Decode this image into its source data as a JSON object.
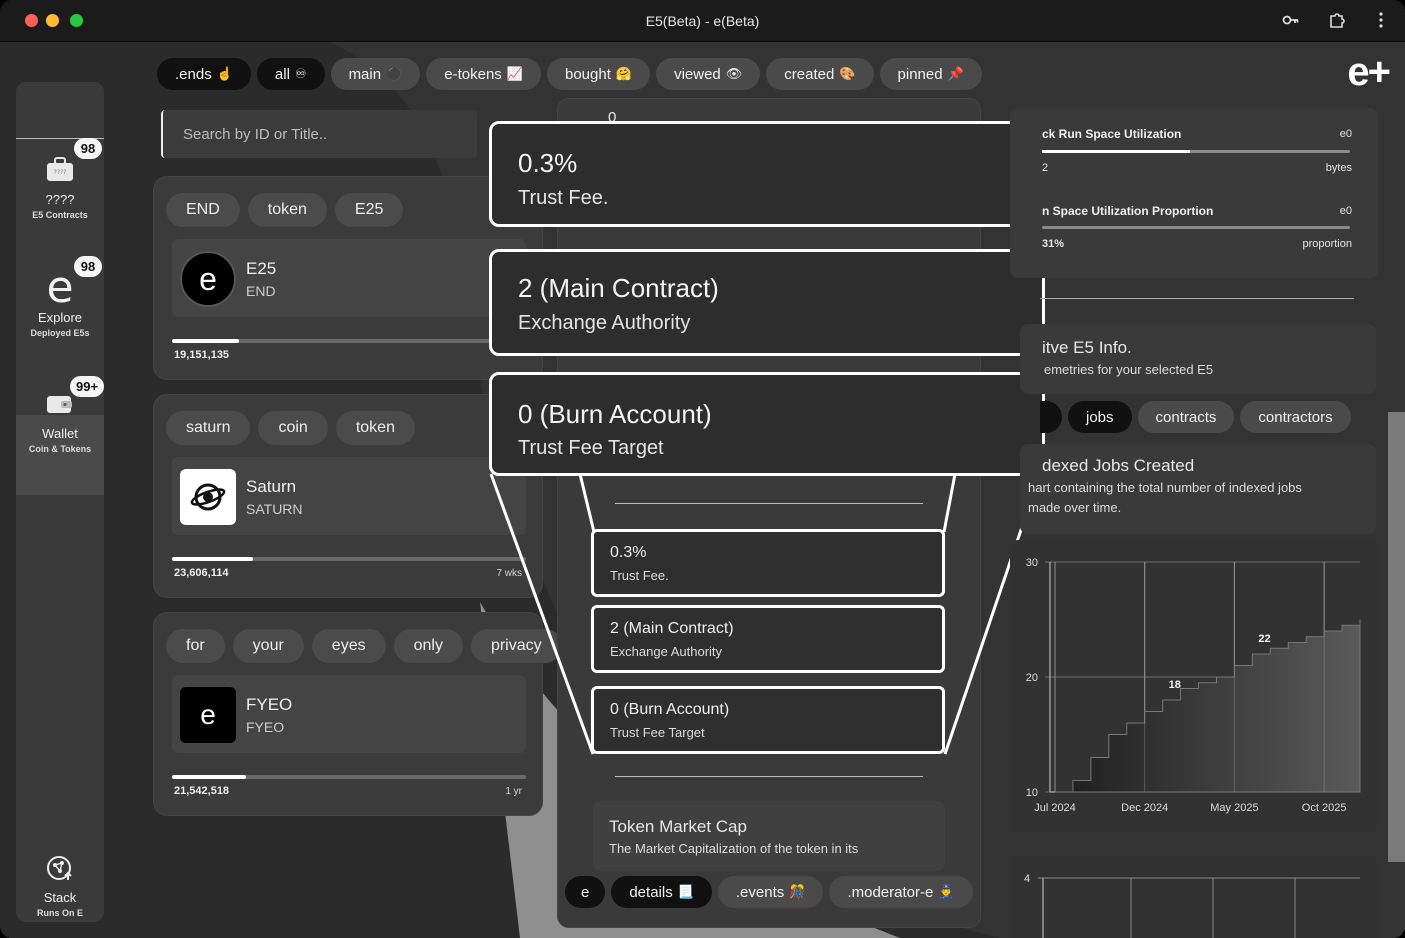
{
  "window": {
    "title": "E5(Beta) - e(Beta)",
    "toolbar_icons": [
      "key-icon",
      "extension-icon",
      "more-vertical-icon"
    ]
  },
  "sidebar": {
    "items": [
      {
        "icon": "briefcase-icon",
        "label": "????",
        "sub": "E5 Contracts",
        "badge": "98"
      },
      {
        "icon": "e-logo-icon",
        "label": "Explore",
        "sub": "Deployed E5s",
        "badge": "98"
      },
      {
        "icon": "wallet-icon",
        "label": "Wallet",
        "sub": "Coin & Tokens",
        "badge": "99+"
      },
      {
        "icon": "stack-icon",
        "label": "Stack",
        "sub": "Runs On E"
      }
    ]
  },
  "top_chips": [
    {
      "label": ".ends",
      "emoji": "☝",
      "dark": true
    },
    {
      "label": "all",
      "emoji": "♾",
      "dark": true
    },
    {
      "label": "main",
      "emoji": "⚫",
      "dark": false
    },
    {
      "label": "e-tokens",
      "emoji": "📈",
      "dark": false
    },
    {
      "label": "bought",
      "emoji": "🤗",
      "dark": false
    },
    {
      "label": "viewed",
      "emoji": "👁",
      "dark": false
    },
    {
      "label": "created",
      "emoji": "🎨",
      "dark": false
    },
    {
      "label": "pinned",
      "emoji": "📌",
      "dark": false
    }
  ],
  "brand": {
    "logo_text": "e+"
  },
  "search": {
    "placeholder": "Search by ID or Title.."
  },
  "tokens": [
    {
      "tags": [
        "END",
        "token",
        "E25"
      ],
      "name": "E25",
      "symbol": "END",
      "amount": "19,151,135",
      "age": "",
      "progress": 0.19
    },
    {
      "tags": [
        "saturn",
        "coin",
        "token"
      ],
      "name": "Saturn",
      "symbol": "SATURN",
      "amount": "23,606,114",
      "age": "7 wks",
      "progress": 0.23
    },
    {
      "tags": [
        "for",
        "your",
        "eyes",
        "only",
        "privacy"
      ],
      "name": "FYEO",
      "symbol": "FYEO",
      "amount": "21,542,518",
      "age": "1 yr",
      "progress": 0.21
    }
  ],
  "middle": {
    "top_fragment": "0",
    "popups": [
      {
        "value": "0.3%",
        "label": "Trust Fee."
      },
      {
        "value": "2 (Main Contract)",
        "label": "Exchange Authority"
      },
      {
        "value": "0 (Burn Account)",
        "label": "Trust Fee Target"
      }
    ],
    "details": [
      {
        "value": "0.3%",
        "label": "Trust Fee."
      },
      {
        "value": "2 (Main Contract)",
        "label": "Exchange Authority"
      },
      {
        "value": "0 (Burn Account)",
        "label": "Trust Fee Target"
      }
    ],
    "market_cap": {
      "title": "Token Market Cap",
      "desc": "The Market Capitalization of the token in its"
    },
    "bottom_chips": [
      {
        "label": "e",
        "emoji": "",
        "dark": true
      },
      {
        "label": "details",
        "emoji": "📃",
        "dark": true
      },
      {
        "label": ".events",
        "emoji": "🎊",
        "dark": false
      },
      {
        "label": ".moderator-e",
        "emoji": "👮",
        "dark": false
      }
    ]
  },
  "right": {
    "util1": {
      "label": "ck Run Space Utilization",
      "unit_top": "e0",
      "left_val": "2",
      "unit": "bytes",
      "progress": 0.48
    },
    "util2": {
      "label": "n Space Utilization Proportion",
      "unit_top": "e0",
      "left_val": "31%",
      "unit": "proportion",
      "progress": 0.0
    },
    "info": {
      "title": "itve E5 Info.",
      "sub": "emetries for your selected E5"
    },
    "tabs": [
      "jobs",
      "contracts",
      "contractors"
    ],
    "jobs": {
      "title": "dexed Jobs Created",
      "desc1": "hart containing the total number of indexed jobs",
      "desc2": "made over time."
    },
    "chart_axis_top": "4"
  },
  "chart_data": {
    "type": "area",
    "title": "",
    "xlabel": "",
    "ylabel": "",
    "x_ticks": [
      "Jul 2024",
      "Dec 2024",
      "May 2025",
      "Oct 2025"
    ],
    "y_ticks": [
      10,
      20,
      30
    ],
    "ylim": [
      10,
      30
    ],
    "annotations": [
      {
        "x": "Jan 2025",
        "y": 18,
        "label": "18"
      },
      {
        "x": "Jun 2025",
        "y": 22,
        "label": "22"
      }
    ],
    "series": [
      {
        "values": [
          {
            "x": "Jul 2024",
            "y": 10
          },
          {
            "x": "Aug 2024",
            "y": 11
          },
          {
            "x": "Sep 2024",
            "y": 13
          },
          {
            "x": "Oct 2024",
            "y": 15
          },
          {
            "x": "Nov 2024",
            "y": 16
          },
          {
            "x": "Dec 2024",
            "y": 17
          },
          {
            "x": "Jan 2025",
            "y": 18
          },
          {
            "x": "Feb 2025",
            "y": 19
          },
          {
            "x": "Mar 2025",
            "y": 19.5
          },
          {
            "x": "Apr 2025",
            "y": 20
          },
          {
            "x": "May 2025",
            "y": 21
          },
          {
            "x": "Jun 2025",
            "y": 22
          },
          {
            "x": "Jul 2025",
            "y": 22.5
          },
          {
            "x": "Aug 2025",
            "y": 23
          },
          {
            "x": "Sep 2025",
            "y": 23.5
          },
          {
            "x": "Oct 2025",
            "y": 24
          },
          {
            "x": "Nov 2025",
            "y": 24.5
          },
          {
            "x": "Dec 2025",
            "y": 25
          }
        ]
      }
    ]
  }
}
